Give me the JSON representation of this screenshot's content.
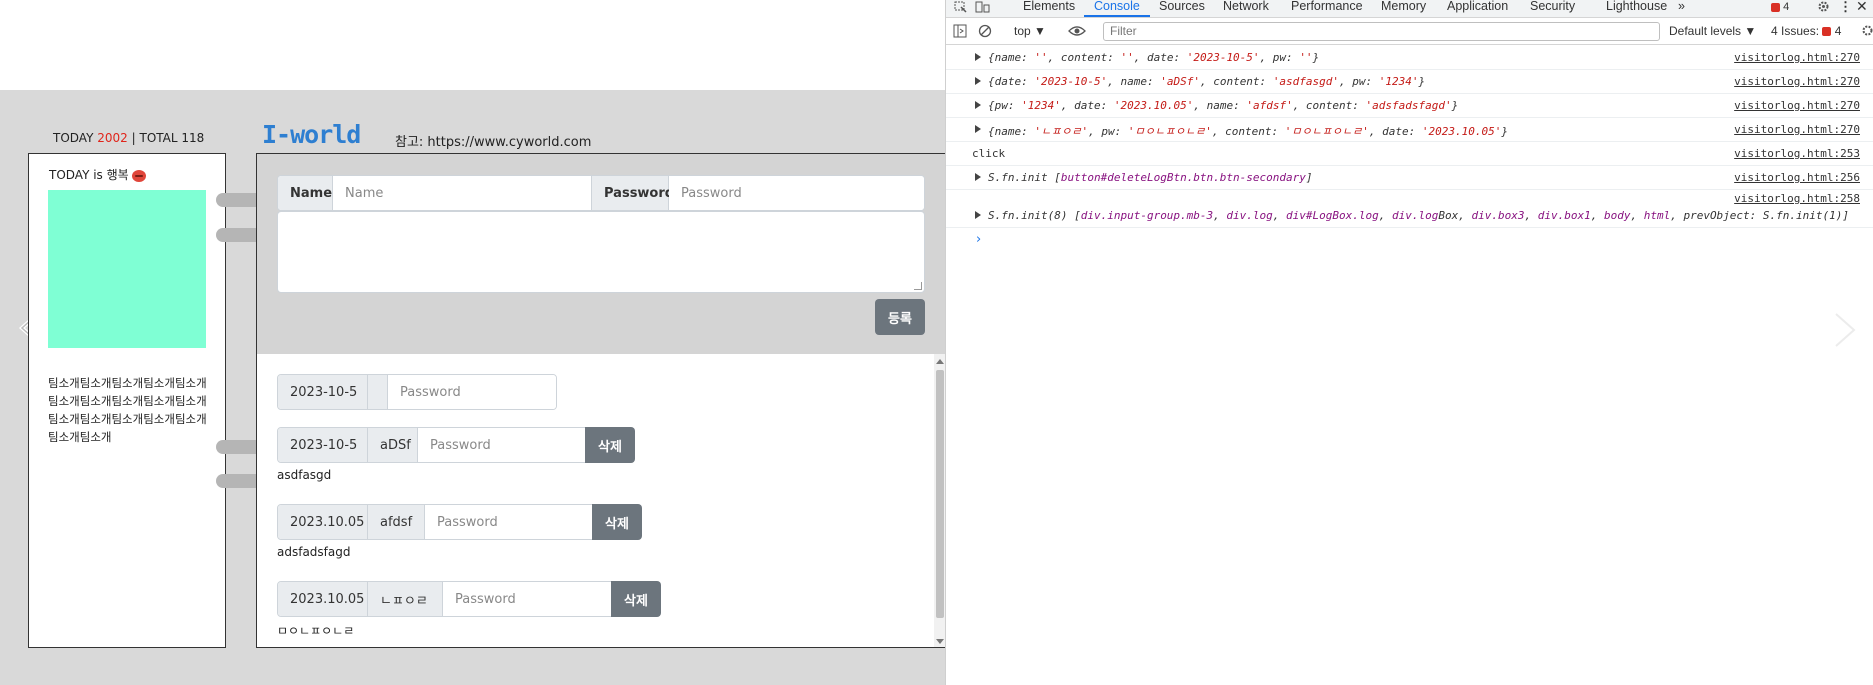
{
  "page": {
    "stats": {
      "today_label": "TODAY",
      "today_count": "2002",
      "separator": "|",
      "total_label": "TOTAL",
      "total_count": "118"
    },
    "site_title": "I-world",
    "reference": "참고: https://www.cyworld.com",
    "profile": {
      "mood": "TODAY is 행복",
      "image_color": "#7fffd4",
      "intro": "팀소개팀소개팀소개팀소개팀소개팀소개팀소개팀소개팀소개팀소개팀소개팀소개팀소개팀소개팀소개팀소개팀소개"
    },
    "form": {
      "name_label": "Name",
      "name_placeholder": "Name",
      "password_label": "Password",
      "password_placeholder": "Password",
      "register_button": "등록"
    },
    "logs": [
      {
        "date": "2023-10-5",
        "name": "",
        "password_placeholder": "Password",
        "delete_label": "",
        "content": ""
      },
      {
        "date": "2023-10-5",
        "name": "aDSf",
        "password_placeholder": "Password",
        "delete_label": "삭제",
        "content": "asdfasgd"
      },
      {
        "date": "2023.10.05",
        "name": "afdsf",
        "password_placeholder": "Password",
        "delete_label": "삭제",
        "content": "adsfadsfagd"
      },
      {
        "date": "2023.10.05",
        "name": "ㄴㅍㅇㄹ",
        "password_placeholder": "Password",
        "delete_label": "삭제",
        "content": "ㅁㅇㄴㅍㅇㄴㄹ"
      }
    ]
  },
  "devtools": {
    "tabs": [
      "Elements",
      "Console",
      "Sources",
      "Network",
      "Performance",
      "Memory",
      "Application",
      "Security",
      "Lighthouse",
      "»"
    ],
    "active_tab": "Console",
    "error_count": "4",
    "context": "top",
    "filter_placeholder": "Filter",
    "levels": "Default levels",
    "issues_label": "4 Issues:",
    "issues_count": "4",
    "console_rows": [
      {
        "expandable": true,
        "source": "visitorlog.html:270"
      },
      {
        "expandable": true,
        "source": "visitorlog.html:270"
      },
      {
        "expandable": true,
        "source": "visitorlog.html:270"
      },
      {
        "expandable": true,
        "source": "visitorlog.html:270"
      },
      {
        "expandable": false,
        "text": "click",
        "source": "visitorlog.html:253"
      },
      {
        "expandable": true,
        "source": "visitorlog.html:256"
      },
      {
        "expandable": false,
        "text": "",
        "source": "visitorlog.html:258"
      },
      {
        "expandable": true,
        "source": ""
      }
    ],
    "row_texts": {
      "r0": "{name: '', content: '', date: '2023-10-5', pw: ''}",
      "r1": "{date: '2023-10-5', name: 'aDSf', content: 'asdfasgd', pw: '1234'}",
      "r2": "{pw: '1234', date: '2023.10.05', name: 'afdsf', content: 'adsfadsfagd'}",
      "r3": "{name: 'ㄴㅍㅇㄹ', pw: 'ㅁㅇㄴㅍㅇㄴㄹ', content: 'ㅁㅇㄴㅍㅇㄴㄹ', date: '2023.10.05'}",
      "r5": "S.fn.init [button#deleteLogBtn.btn.btn-secondary]",
      "r7": "S.fn.init(8) [div.input-group.mb-3, div.log, div#LogBox.log, div.logBox, div.box3, div.box1, body, html, prevObject: S.fn.init(1)]"
    },
    "prompt_symbol": "›"
  }
}
